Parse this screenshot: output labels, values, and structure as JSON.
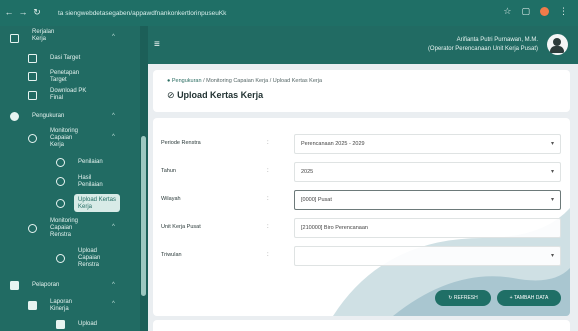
{
  "browser": {
    "url": "ta siengwebdetasegaben/appawdfnankonkertlorinpuseuKk",
    "back_icon": "arrow-left-icon",
    "forward_icon": "arrow-right-icon",
    "reload_icon": "reload-icon"
  },
  "sidebar": {
    "items": [
      {
        "label": "Rerjalan\nKerja",
        "icon": "doc-icon",
        "caret": "^"
      },
      {
        "label": "Dasi Target",
        "icon": "doc-icon"
      },
      {
        "label": "Penetapan\nTarget",
        "icon": "doc-icon"
      },
      {
        "label": "Download PK\nFinal",
        "icon": "doc-icon"
      },
      {
        "label": "Pengukuran",
        "icon": "circle-dot-icon",
        "caret": "^"
      },
      {
        "label": "Monitoring\nCapaian\nKerja",
        "icon": "check-circle-icon",
        "caret": "^"
      },
      {
        "label": "Penilaian",
        "icon": "check-circle-icon"
      },
      {
        "label": "Hasil\nPenilaian",
        "icon": "check-circle-icon"
      },
      {
        "label": "Upload Kertas\nKerja",
        "icon": "check-circle-icon",
        "active": true
      },
      {
        "label": "Monitoring\nCapaian\nRenstra",
        "icon": "check-circle-icon",
        "caret": "^"
      },
      {
        "label": "Upload\nCapaian\nRenstra",
        "icon": "check-circle-icon"
      },
      {
        "label": "Pelaporan",
        "icon": "square-icon",
        "caret": "^"
      },
      {
        "label": "Laporan\nKinerja",
        "icon": "doc-icon",
        "caret": "^"
      },
      {
        "label": "Upload",
        "icon": "doc-icon"
      }
    ]
  },
  "header": {
    "menu_icon": "hamburger-icon",
    "user_name": "Arifianta Putri Purnawan, M.M.",
    "user_role": "(Operator Perencanaan Unit Kerja Pusat)",
    "avatar_icon": "user-avatar-icon"
  },
  "breadcrumb": {
    "home": "Pengukuran",
    "sep1": "/",
    "mid": "Monitoring Capaian Kerja",
    "sep2": "/",
    "current": "Upload Kertas Kerja"
  },
  "page_title": "Upload Kertas Kerja",
  "form": {
    "fields": [
      {
        "label": "Periode Renstra",
        "value": "Perencanaan 2025 - 2029"
      },
      {
        "label": "Tahun",
        "value": "2025"
      },
      {
        "label": "Wilayah",
        "value": "[0000] Pusat"
      },
      {
        "label": "Unit Kerja Pusat",
        "value": "[210000] Biro Perencanaan"
      },
      {
        "label": "Triwulan",
        "value": ""
      }
    ],
    "colon": ":",
    "refresh_label": "REFRESH",
    "add_label": "+ TAMBAH DATA"
  }
}
